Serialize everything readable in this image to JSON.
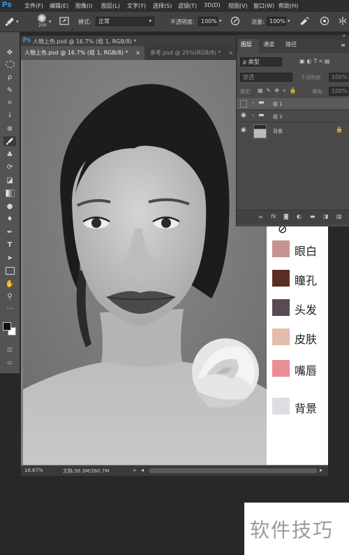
{
  "app": {
    "logo": "Ps"
  },
  "menu": [
    "文件(F)",
    "编辑(E)",
    "图像(I)",
    "图层(L)",
    "文字(Y)",
    "选择(S)",
    "滤镜(T)",
    "3D(D)",
    "视图(V)",
    "窗口(W)",
    "帮助(H)"
  ],
  "options": {
    "brush_size": "200",
    "mode_label": "模式:",
    "mode_value": "正常",
    "opacity_label": "不透明度:",
    "opacity_value": "100%",
    "flow_label": "流量:",
    "flow_value": "100%"
  },
  "document": {
    "window_title": "人物上色.psd @ 16.7% (组 1, RGB/8) *",
    "tabs": [
      {
        "label": "人物上色.psd @ 16.7% (组 1, RGB/8) *",
        "close": "×"
      },
      {
        "label": "参考.psd @ 25%(RGB/8) *",
        "close": "×"
      }
    ],
    "status": {
      "zoom": "16.67%",
      "doc_size": "文档:56.3M/260.7M",
      "arrow": ">"
    }
  },
  "layers_panel": {
    "tabs": [
      "图层",
      "通道",
      "路径"
    ],
    "filter_label": "ρ 类型",
    "blend_mode": "穿透",
    "opacity_label": "不透明度:",
    "opacity_value": "100%",
    "lock_label": "锁定:",
    "fill_label": "填充:",
    "fill_value": "100%",
    "layers": [
      {
        "name": "组 1",
        "type": "group",
        "visible": false
      },
      {
        "name": "组 2",
        "type": "group",
        "visible": true
      },
      {
        "name": "背景",
        "type": "image",
        "visible": true,
        "locked": true
      }
    ],
    "footer_icons": [
      "link-icon",
      "fx-icon",
      "mask-icon",
      "adjustment-icon",
      "folder-icon",
      "new-layer-icon",
      "trash-icon"
    ]
  },
  "swatches": {
    "no_symbol": "⊘",
    "items": [
      {
        "label": "眼白",
        "color": "#c69290"
      },
      {
        "label": "瞳孔",
        "color": "#5c2d25"
      },
      {
        "label": "头发",
        "color": "#5a4a56"
      },
      {
        "label": "皮肤",
        "color": "#e3bcac"
      },
      {
        "label": "嘴唇",
        "color": "#ea8e92"
      },
      {
        "label": "背景",
        "color": "#dfdce3"
      }
    ]
  },
  "watermark": "软件技巧",
  "colors": {
    "accent": "#31a8ff",
    "panel": "#4a4a4a",
    "toolbar": "#535353"
  }
}
